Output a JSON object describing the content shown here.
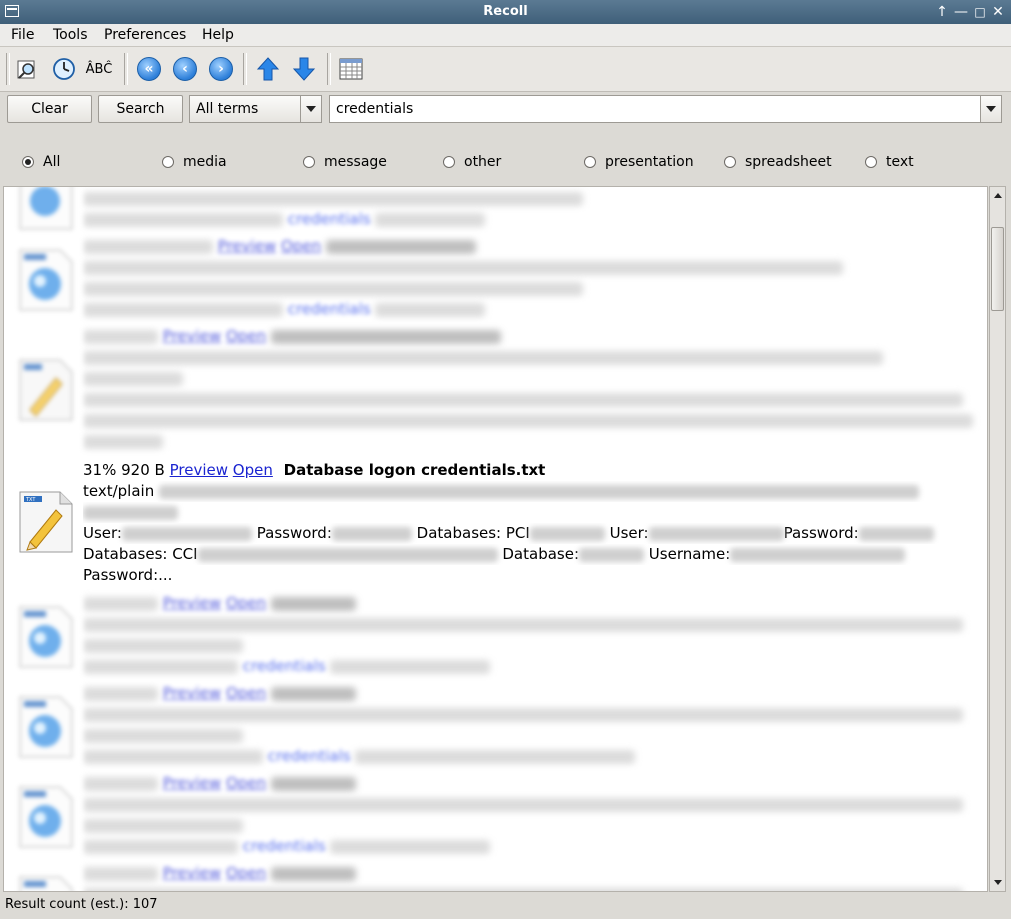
{
  "window": {
    "title": "Recoll"
  },
  "menu": [
    "File",
    "Tools",
    "Preferences",
    "Help"
  ],
  "search": {
    "clear_label": "Clear",
    "search_label": "Search",
    "mode": "All terms",
    "query": "credentials"
  },
  "filters": [
    {
      "label": "All",
      "selected": true
    },
    {
      "label": "media",
      "selected": false
    },
    {
      "label": "message",
      "selected": false
    },
    {
      "label": "other",
      "selected": false
    },
    {
      "label": "presentation",
      "selected": false
    },
    {
      "label": "spreadsheet",
      "selected": false
    },
    {
      "label": "text",
      "selected": false
    }
  ],
  "focus_result": {
    "relevance": "31%",
    "size": "920 B",
    "preview_label": "Preview",
    "open_label": "Open",
    "title": "Database logon credentials.txt",
    "mimetype": "text/plain",
    "snippet_parts": [
      "User:",
      "Password:",
      "Databases: PCI",
      "User:",
      "Password:",
      "Databases: CCI",
      "Database:",
      "Username:",
      "Password:..."
    ]
  },
  "other_results": {
    "preview_label": "Preview",
    "open_label": "Open",
    "keyword": "credentials"
  },
  "status": {
    "result_count": "Result count (est.): 107"
  }
}
